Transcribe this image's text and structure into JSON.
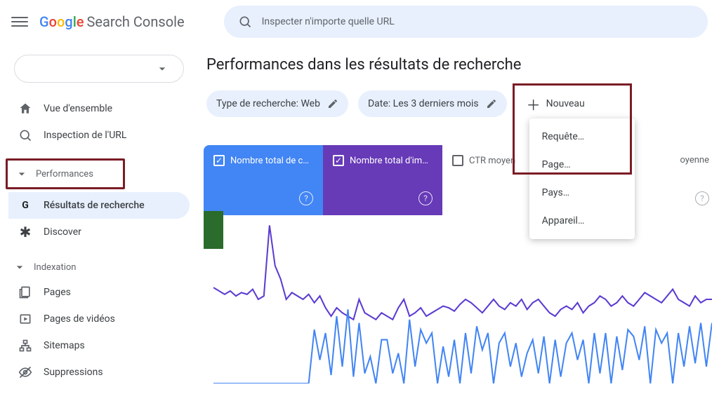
{
  "app": {
    "title": "Search Console",
    "google": "Google"
  },
  "search": {
    "placeholder": "Inspecter n'importe quelle URL"
  },
  "sidebar": {
    "items": {
      "overview": "Vue d'ensemble",
      "inspect": "Inspection de l'URL",
      "performances": "Performances",
      "results": "Résultats de recherche",
      "discover": "Discover",
      "indexation": "Indexation",
      "pages": "Pages",
      "videos": "Pages de vidéos",
      "sitemaps": "Sitemaps",
      "removals": "Suppressions"
    }
  },
  "main": {
    "title": "Performances dans les résultats de recherche",
    "chips": {
      "type": "Type de recherche: Web",
      "date": "Date: Les 3 derniers mois"
    },
    "new": "Nouveau",
    "dropdown": [
      "Requête…",
      "Page…",
      "Pays…",
      "Appareil…"
    ],
    "metrics": {
      "clicks": "Nombre total de c…",
      "impressions": "Nombre total d'im…",
      "ctr": "CTR moyen",
      "position": "oyenne"
    }
  },
  "chart_data": {
    "type": "line",
    "title": "",
    "xlabel": "",
    "ylabel": "",
    "ylim": [
      0,
      100
    ],
    "x": [
      0,
      1,
      2,
      3,
      4,
      5,
      6,
      7,
      8,
      9,
      10,
      11,
      12,
      13,
      14,
      15,
      16,
      17,
      18,
      19,
      20,
      21,
      22,
      23,
      24,
      25,
      26,
      27,
      28,
      29,
      30,
      31,
      32,
      33,
      34,
      35,
      36,
      37,
      38,
      39,
      40,
      41,
      42,
      43,
      44,
      45,
      46,
      47,
      48,
      49,
      50,
      51,
      52,
      53,
      54,
      55,
      56,
      57,
      58,
      59,
      60,
      61,
      62,
      63,
      64,
      65,
      66,
      67,
      68,
      69,
      70,
      71,
      72,
      73,
      74,
      75,
      76,
      77,
      78,
      79,
      80,
      81,
      82,
      83,
      84,
      85,
      86,
      87,
      88,
      89
    ],
    "series": [
      {
        "name": "Impressions",
        "color": "#5b3bd1",
        "values": [
          57,
          55,
          53,
          55,
          52,
          54,
          53,
          56,
          50,
          52,
          94,
          70,
          62,
          50,
          54,
          52,
          50,
          53,
          48,
          52,
          45,
          40,
          45,
          42,
          40,
          38,
          50,
          42,
          40,
          38,
          42,
          40,
          38,
          45,
          50,
          40,
          42,
          45,
          40,
          42,
          44,
          46,
          45,
          43,
          47,
          50,
          48,
          45,
          42,
          46,
          50,
          46,
          44,
          48,
          46,
          50,
          44,
          48,
          50,
          46,
          42,
          40,
          44,
          46,
          44,
          48,
          42,
          46,
          48,
          52,
          50,
          46,
          48,
          52,
          48,
          46,
          50,
          54,
          52,
          50,
          48,
          52,
          56,
          50,
          48,
          46,
          52,
          48,
          50,
          50
        ]
      },
      {
        "name": "Clics",
        "color": "#4285F4",
        "values": [
          0,
          0,
          0,
          0,
          0,
          0,
          0,
          0,
          0,
          0,
          0,
          0,
          0,
          0,
          0,
          0,
          0,
          0,
          32,
          14,
          30,
          5,
          40,
          10,
          44,
          4,
          36,
          6,
          16,
          0,
          26,
          26,
          6,
          18,
          0,
          38,
          10,
          32,
          24,
          30,
          0,
          22,
          4,
          26,
          0,
          30,
          6,
          34,
          20,
          30,
          0,
          24,
          30,
          10,
          24,
          4,
          18,
          26,
          6,
          28,
          0,
          26,
          4,
          24,
          30,
          14,
          26,
          0,
          30,
          6,
          30,
          0,
          28,
          8,
          32,
          28,
          14,
          34,
          0,
          32,
          24,
          30,
          0,
          30,
          10,
          34,
          12,
          36,
          10,
          36
        ]
      }
    ]
  }
}
